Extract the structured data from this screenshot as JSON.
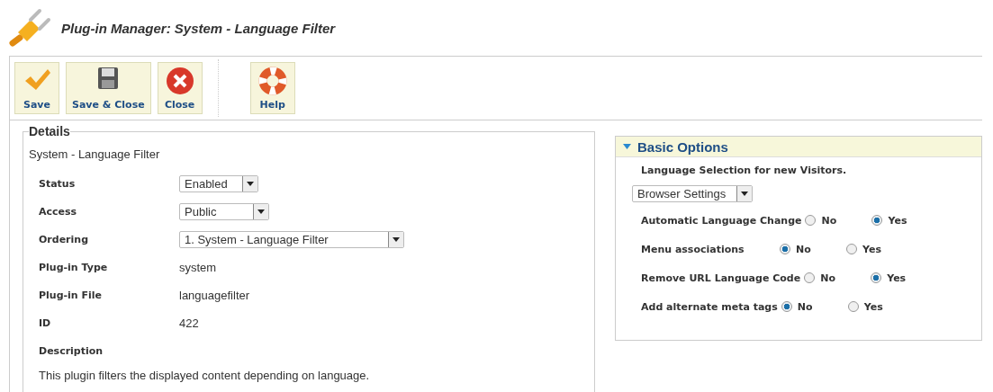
{
  "header": {
    "title": "Plug-in Manager: System - Language Filter"
  },
  "toolbar": [
    {
      "label": "Save",
      "kind": "save"
    },
    {
      "label": "Save & Close",
      "kind": "save-close"
    },
    {
      "label": "Close",
      "kind": "close"
    },
    {
      "label": "Help",
      "kind": "help",
      "separated": true
    }
  ],
  "details": {
    "legend": "Details",
    "heading": "System - Language Filter",
    "rows": [
      {
        "label": "Status",
        "kind": "select",
        "value": "Enabled"
      },
      {
        "label": "Access",
        "kind": "select",
        "value": "Public"
      },
      {
        "label": "Ordering",
        "kind": "select",
        "value": "1. System - Language Filter"
      },
      {
        "label": "Plug-in Type",
        "kind": "text",
        "value": "system"
      },
      {
        "label": "Plug-in File",
        "kind": "text",
        "value": "languagefilter"
      },
      {
        "label": "ID",
        "kind": "text",
        "value": "422"
      },
      {
        "label": "Description",
        "kind": "heading"
      }
    ],
    "description": "This plugin filters the displayed content depending on language."
  },
  "options": {
    "title": "Basic Options",
    "expanded": true,
    "intro": "Language Selection for new Visitors.",
    "select": "Browser Settings",
    "radios": [
      {
        "label": "Automatic Language Change",
        "choices": [
          {
            "label": "No",
            "selected": false
          },
          {
            "label": "Yes",
            "selected": true
          }
        ]
      },
      {
        "label": "Menu associations",
        "choices": [
          {
            "label": "No",
            "selected": true
          },
          {
            "label": "Yes",
            "selected": false
          }
        ]
      },
      {
        "label": "Remove URL Language Code",
        "choices": [
          {
            "label": "No",
            "selected": false
          },
          {
            "label": "Yes",
            "selected": true
          }
        ]
      },
      {
        "label": "Add alternate meta tags",
        "choices": [
          {
            "label": "No",
            "selected": true
          },
          {
            "label": "Yes",
            "selected": false
          }
        ]
      }
    ]
  }
}
